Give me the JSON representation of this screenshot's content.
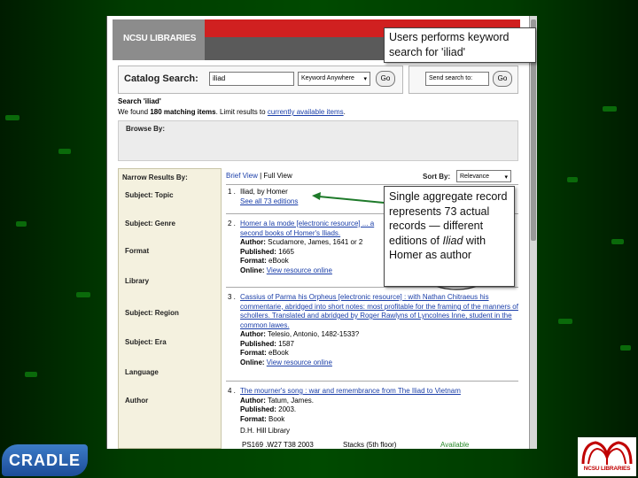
{
  "catalog": {
    "brand": "NCSU LIBRARIES",
    "search_label": "Catalog Search:",
    "search_value": "iliad",
    "search_scope": "Keyword Anywhere",
    "go_label": "Go",
    "sendto_label": "Send search to:",
    "search_term_line": "Search 'iliad'",
    "found_prefix": "We found ",
    "found_count": "180 matching items",
    "found_mid": ". Limit results to ",
    "found_link": "currently available items",
    "found_suffix": ".",
    "browse_label": "Browse By:"
  },
  "narrow": {
    "title": "Narrow Results By:",
    "facets": [
      "Subject: Topic",
      "Subject: Genre",
      "Format",
      "Library",
      "Subject: Region",
      "Subject: Era",
      "Language",
      "Author"
    ]
  },
  "results_header": {
    "brief_view": "Brief View",
    "separator": "|",
    "full_view": "Full View",
    "sort_label": "Sort By:",
    "sort_value": "Relevance"
  },
  "results": [
    {
      "num": "1 .",
      "title": "Iliad, by Homer",
      "link": "See all 73 editions"
    },
    {
      "num": "2 .",
      "title": "Homer a la mode [electronic resource] ... a second books of Homer's Iliads.",
      "author_label": "Author:",
      "author": "Scudamore, James, 1641 or 2",
      "published_label": "Published:",
      "published": "1665",
      "format_label": "Format:",
      "format": "eBook",
      "online_label": "Online:",
      "online": "View resource online"
    },
    {
      "num": "3 .",
      "title": "Cassius of Parma his Orpheus [electronic resource] : with Nathan Chitraeus his commentarie, abridged into short notes: most profitable for the framing of the manners of schollers. Translated and abridged by Roger Rawlyns of Lyncolnes Inne, student in the common lawes.",
      "author_label": "Author:",
      "author": "Telesio, Antonio, 1482-1533?",
      "published_label": "Published:",
      "published": "1587",
      "format_label": "Format:",
      "format": "eBook",
      "online_label": "Online:",
      "online": "View resource online"
    },
    {
      "num": "4 .",
      "title": "The mourner's song : war and remembrance from The Iliad to Vietnam",
      "author_label": "Author:",
      "author": "Tatum, James.",
      "published_label": "Published:",
      "published": "2003.",
      "format_label": "Format:",
      "format": "Book",
      "library": "D.H. Hill Library",
      "call_number": "PS169 .W27 T38 2003",
      "location": "Stacks (5th floor)",
      "status": "Available"
    }
  ],
  "callouts": {
    "top": "Users performs keyword search for 'iliad'",
    "bottom_a": "Single aggregate record represents 73 actual records — different editions of ",
    "bottom_italic": "Iliad",
    "bottom_b": " with Homer as author"
  },
  "logos": {
    "cradle": "CRADLE",
    "ncsu": "NCSU LIBRARIES"
  }
}
